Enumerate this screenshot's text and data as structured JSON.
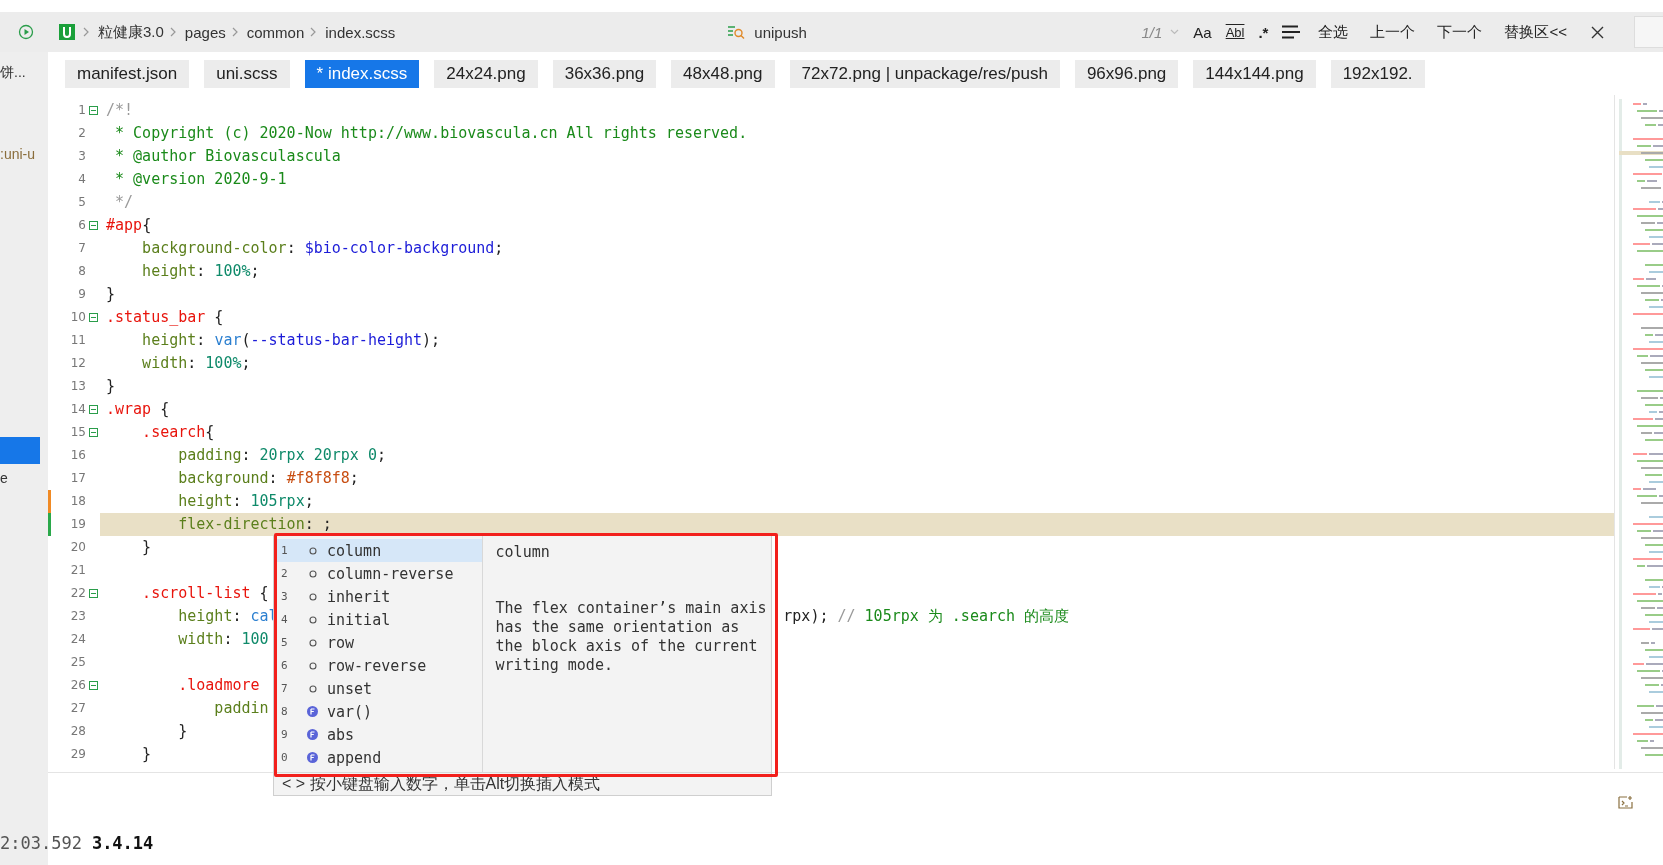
{
  "toolbar": {
    "breadcrumbs": [
      "粒健康3.0",
      "pages",
      "common",
      "index.scss"
    ],
    "search_scope": "unipush",
    "match_count": "1/1",
    "options": [
      "Aa",
      "Abl",
      ".*"
    ],
    "actions": [
      "全选",
      "上一个",
      "下一个",
      "替换区<<"
    ]
  },
  "sidebar": {
    "items": [
      {
        "label": "饼...",
        "selected": false
      },
      {
        "label": ":uni-u",
        "selected": false
      },
      {
        "selected": true
      },
      {
        "label": "e",
        "selected": false
      }
    ]
  },
  "tabs": [
    {
      "label": "manifest.json",
      "selected": false
    },
    {
      "label": "uni.scss",
      "selected": false
    },
    {
      "label": "* index.scss",
      "selected": true
    },
    {
      "label": "24x24.png",
      "selected": false
    },
    {
      "label": "36x36.png",
      "selected": false
    },
    {
      "label": "48x48.png",
      "selected": false
    },
    {
      "label": "72x72.png | unpackage/res/push",
      "selected": false
    },
    {
      "label": "96x96.png",
      "selected": false
    },
    {
      "label": "144x144.png",
      "selected": false
    },
    {
      "label": "192x192.",
      "selected": false
    }
  ],
  "editor": {
    "lines": [
      {
        "n": "1",
        "foldable": true,
        "current": false,
        "tokens": [
          {
            "t": "/*!",
            "kind": "mark"
          }
        ]
      },
      {
        "n": "2",
        "foldable": false,
        "current": false,
        "tokens": [
          {
            "t": " * Copyright (c) 2020-Now http://www.biovascula.cn All rights reserved.",
            "kind": "comment"
          }
        ]
      },
      {
        "n": "3",
        "foldable": false,
        "current": false,
        "tokens": [
          {
            "t": " * @author Biovasculascula",
            "kind": "comment"
          }
        ]
      },
      {
        "n": "4",
        "foldable": false,
        "current": false,
        "tokens": [
          {
            "t": " * @version 2020-9-1",
            "kind": "comment"
          }
        ]
      },
      {
        "n": "5",
        "foldable": false,
        "current": false,
        "tokens": [
          {
            "t": " */",
            "kind": "mark"
          }
        ]
      },
      {
        "n": "6",
        "foldable": true,
        "current": false,
        "tokens": [
          {
            "t": "#app",
            "kind": "selector"
          },
          {
            "t": "{",
            "kind": "punct"
          }
        ]
      },
      {
        "n": "7",
        "foldable": false,
        "current": false,
        "tokens": [
          {
            "t": "    background-color",
            "kind": "property"
          },
          {
            "t": ": ",
            "kind": "punct"
          },
          {
            "t": "$bio-color-background",
            "kind": "variable"
          },
          {
            "t": ";",
            "kind": "punct"
          }
        ]
      },
      {
        "n": "8",
        "foldable": false,
        "current": false,
        "tokens": [
          {
            "t": "    height",
            "kind": "property"
          },
          {
            "t": ": ",
            "kind": "punct"
          },
          {
            "t": "100%",
            "kind": "number"
          },
          {
            "t": ";",
            "kind": "punct"
          }
        ]
      },
      {
        "n": "9",
        "foldable": false,
        "current": false,
        "tokens": [
          {
            "t": "}",
            "kind": "punct"
          }
        ]
      },
      {
        "n": "10",
        "foldable": true,
        "current": false,
        "tokens": [
          {
            "t": ".status_bar",
            "kind": "selector"
          },
          {
            "t": " {",
            "kind": "punct"
          }
        ]
      },
      {
        "n": "11",
        "foldable": false,
        "current": false,
        "tokens": [
          {
            "t": "    height",
            "kind": "property"
          },
          {
            "t": ": ",
            "kind": "punct"
          },
          {
            "t": "var",
            "kind": "function"
          },
          {
            "t": "(",
            "kind": "punct"
          },
          {
            "t": "--status-bar-height",
            "kind": "variable"
          },
          {
            "t": ");",
            "kind": "punct"
          }
        ]
      },
      {
        "n": "12",
        "foldable": false,
        "current": false,
        "tokens": [
          {
            "t": "    width",
            "kind": "property"
          },
          {
            "t": ": ",
            "kind": "punct"
          },
          {
            "t": "100%",
            "kind": "number"
          },
          {
            "t": ";",
            "kind": "punct"
          }
        ]
      },
      {
        "n": "13",
        "foldable": false,
        "current": false,
        "tokens": [
          {
            "t": "}",
            "kind": "punct"
          }
        ]
      },
      {
        "n": "14",
        "foldable": true,
        "current": false,
        "tokens": [
          {
            "t": ".wrap",
            "kind": "selector"
          },
          {
            "t": " {",
            "kind": "punct"
          }
        ]
      },
      {
        "n": "15",
        "foldable": true,
        "current": false,
        "tokens": [
          {
            "t": "    .search",
            "kind": "selector"
          },
          {
            "t": "{",
            "kind": "punct"
          }
        ]
      },
      {
        "n": "16",
        "foldable": false,
        "current": false,
        "tokens": [
          {
            "t": "        padding",
            "kind": "property"
          },
          {
            "t": ": ",
            "kind": "punct"
          },
          {
            "t": "20rpx 20rpx 0",
            "kind": "number"
          },
          {
            "t": ";",
            "kind": "punct"
          }
        ]
      },
      {
        "n": "17",
        "foldable": false,
        "current": false,
        "tokens": [
          {
            "t": "        background",
            "kind": "property"
          },
          {
            "t": ": ",
            "kind": "punct"
          },
          {
            "t": "#f8f8f8",
            "kind": "hex"
          },
          {
            "t": ";",
            "kind": "punct"
          }
        ]
      },
      {
        "n": "18",
        "foldable": false,
        "current": false,
        "color": "#f08a24",
        "tokens": [
          {
            "t": "        height",
            "kind": "property"
          },
          {
            "t": ": ",
            "kind": "punct"
          },
          {
            "t": "105rpx",
            "kind": "number"
          },
          {
            "t": ";",
            "kind": "punct"
          }
        ]
      },
      {
        "n": "19",
        "foldable": false,
        "current": true,
        "color": "#2aa84a",
        "tokens": [
          {
            "t": "        flex-direction",
            "kind": "property"
          },
          {
            "t": ": ;",
            "kind": "punct"
          }
        ]
      },
      {
        "n": "20",
        "foldable": false,
        "current": false,
        "tokens": [
          {
            "t": "    }",
            "kind": "punct"
          }
        ]
      },
      {
        "n": "21",
        "foldable": false,
        "current": false
      },
      {
        "n": "22",
        "foldable": true,
        "current": false,
        "tokens": [
          {
            "t": "    .scroll-list",
            "kind": "selector"
          },
          {
            "t": " {",
            "kind": "punct"
          }
        ]
      },
      {
        "n": "23",
        "foldable": false,
        "current": false,
        "tokens": [
          {
            "t": "        height",
            "kind": "property"
          },
          {
            "t": ": ",
            "kind": "punct"
          },
          {
            "t": "cal",
            "kind": "function"
          }
        ],
        "tail": [
          {
            "t": "rpx);",
            "kind": "punct"
          },
          {
            "t": " // ",
            "kind": "mark"
          },
          {
            "t": "105rpx 为 .search 的高度",
            "kind": "comment"
          }
        ]
      },
      {
        "n": "24",
        "foldable": false,
        "current": false,
        "tokens": [
          {
            "t": "        width",
            "kind": "property"
          },
          {
            "t": ": ",
            "kind": "punct"
          },
          {
            "t": "100",
            "kind": "number"
          }
        ]
      },
      {
        "n": "25",
        "foldable": false,
        "current": false
      },
      {
        "n": "26",
        "foldable": true,
        "current": false,
        "tokens": [
          {
            "t": "        .loadmore",
            "kind": "selector"
          }
        ]
      },
      {
        "n": "27",
        "foldable": false,
        "current": false,
        "tokens": [
          {
            "t": "            paddin",
            "kind": "property"
          }
        ]
      },
      {
        "n": "28",
        "foldable": false,
        "current": false,
        "tokens": [
          {
            "t": "        }",
            "kind": "punct"
          }
        ]
      },
      {
        "n": "29",
        "foldable": false,
        "current": false,
        "tokens": [
          {
            "t": "    }",
            "kind": "punct"
          }
        ]
      }
    ]
  },
  "suggestions": {
    "items": [
      {
        "n": "1",
        "kind": "keyword",
        "label": "column",
        "selected": true
      },
      {
        "n": "2",
        "kind": "keyword",
        "label": "column-reverse",
        "selected": false
      },
      {
        "n": "3",
        "kind": "keyword",
        "label": "inherit",
        "selected": false
      },
      {
        "n": "4",
        "kind": "keyword",
        "label": "initial",
        "selected": false
      },
      {
        "n": "5",
        "kind": "keyword",
        "label": "row",
        "selected": false
      },
      {
        "n": "6",
        "kind": "keyword",
        "label": "row-reverse",
        "selected": false
      },
      {
        "n": "7",
        "kind": "keyword",
        "label": "unset",
        "selected": false
      },
      {
        "n": "8",
        "kind": "function",
        "label": "var()",
        "selected": false
      },
      {
        "n": "9",
        "kind": "function",
        "label": "abs",
        "selected": false
      },
      {
        "n": "0",
        "kind": "function",
        "label": "append",
        "selected": false
      }
    ],
    "detail_title": "column",
    "detail_text": "The flex container’s main axis has the same orientation as the block axis of the current writing mode.",
    "hint": "< > 按小键盘输入数字，单击Alt切换插入模式"
  },
  "console": {
    "lines": [
      {
        "time": "2:03.592",
        "message": "3.4.14"
      }
    ]
  }
}
